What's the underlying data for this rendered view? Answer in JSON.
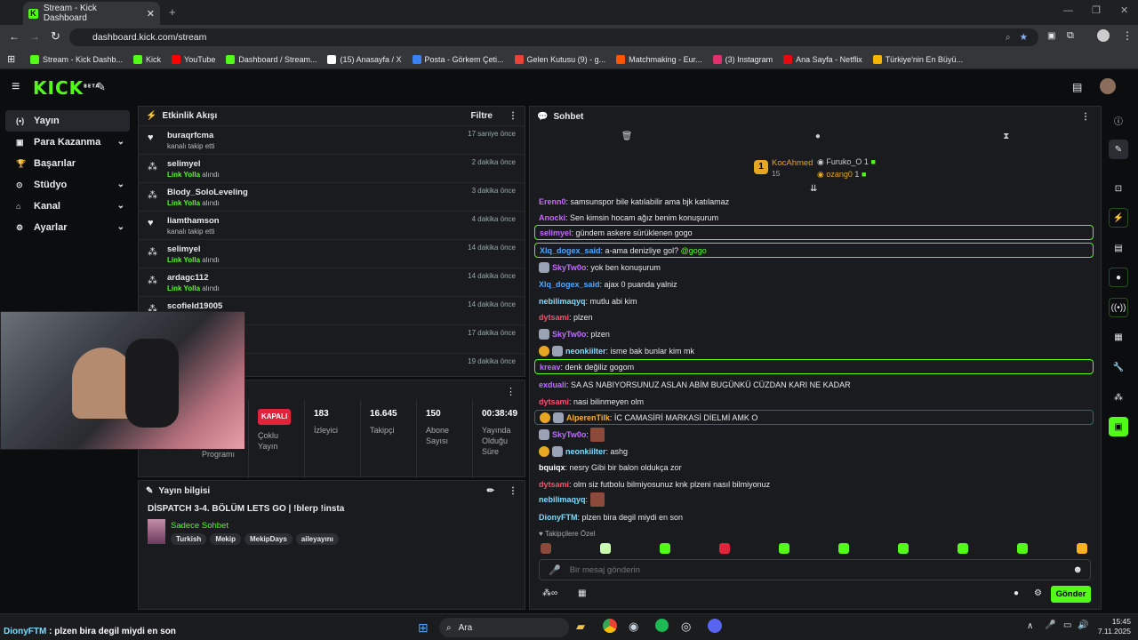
{
  "browser": {
    "tab_title": "Stream - Kick Dashboard",
    "url": "dashboard.kick.com/stream",
    "bookmarks": [
      {
        "label": "Stream - Kick Dashb...",
        "icon": "kick-icon",
        "color": "#53fc18"
      },
      {
        "label": "Kick",
        "icon": "kick-icon",
        "color": "#53fc18"
      },
      {
        "label": "YouTube",
        "icon": "youtube-icon",
        "color": "#ff0000"
      },
      {
        "label": "Dashboard / Stream...",
        "icon": "kick-icon",
        "color": "#53fc18"
      },
      {
        "label": "(15) Anasayfa / X",
        "icon": "x-icon",
        "color": "#ffffff"
      },
      {
        "label": "Posta - Görkem Çeti...",
        "icon": "mail-icon",
        "color": "#3b82f6"
      },
      {
        "label": "Gelen Kutusu (9) - g...",
        "icon": "gmail-icon",
        "color": "#ea4335"
      },
      {
        "label": "Matchmaking - Eur...",
        "icon": "faceit-icon",
        "color": "#ff5500"
      },
      {
        "label": "(3) Instagram",
        "icon": "instagram-icon",
        "color": "#e1306c"
      },
      {
        "label": "Ana Sayfa - Netflix",
        "icon": "netflix-icon",
        "color": "#e50914"
      },
      {
        "label": "Türkiye'nin En Büyü...",
        "icon": "site-icon",
        "color": "#f5b400"
      }
    ]
  },
  "app": {
    "logo": "KICK",
    "logo_badge": "BETA",
    "accent": "#53fc18"
  },
  "sidebar": {
    "items": [
      {
        "label": "Yayın",
        "icon": "broadcast-icon",
        "active": true,
        "chevron": false
      },
      {
        "label": "Para Kazanma",
        "icon": "money-icon",
        "active": false,
        "chevron": true
      },
      {
        "label": "Başarılar",
        "icon": "trophy-icon",
        "active": false,
        "chevron": false
      },
      {
        "label": "Stüdyo",
        "icon": "studio-icon",
        "active": false,
        "chevron": true
      },
      {
        "label": "Kanal",
        "icon": "channel-icon",
        "active": false,
        "chevron": true
      },
      {
        "label": "Ayarlar",
        "icon": "settings-icon",
        "active": false,
        "chevron": true
      }
    ]
  },
  "activity": {
    "title": "Etkinlik Akışı",
    "filter": "Filtre",
    "items": [
      {
        "name": "buraqrfcma",
        "sub_action": "kanalı takip etti",
        "sub_link": "",
        "time": "17 saniye önce",
        "icon": "heart-icon"
      },
      {
        "name": "selimyel",
        "sub_link": "Link Yolla",
        "sub_action": "alındı",
        "time": "2 dakika önce",
        "icon": "points-icon"
      },
      {
        "name": "Blody_SoloLeveling",
        "sub_link": "Link Yolla",
        "sub_action": "alındı",
        "time": "3 dakika önce",
        "icon": "points-icon"
      },
      {
        "name": "liamthamson",
        "sub_action": "kanalı takip etti",
        "sub_link": "",
        "time": "4 dakika önce",
        "icon": "heart-icon"
      },
      {
        "name": "selimyel",
        "sub_link": "Link Yolla",
        "sub_action": "alındı",
        "time": "14 dakika önce",
        "icon": "points-icon"
      },
      {
        "name": "ardagc112",
        "sub_link": "Link Yolla",
        "sub_action": "alındı",
        "time": "14 dakika önce",
        "icon": "points-icon"
      },
      {
        "name": "scofield19005",
        "sub_link": "",
        "sub_action": "",
        "time": "14 dakika önce",
        "icon": "points-icon"
      },
      {
        "name": "",
        "sub_link": "",
        "sub_action": "",
        "time": "17 dakika önce",
        "icon": ""
      },
      {
        "name": "",
        "sub_link": "",
        "sub_action": "",
        "time": "19 dakika önce",
        "icon": ""
      }
    ]
  },
  "stats": {
    "program_label": "Programı",
    "status_badge": "KAPALI",
    "multi_label": "Çoklu Yayın",
    "viewers": {
      "value": "183",
      "label": "İzleyici"
    },
    "followers": {
      "value": "16.645",
      "label": "Takipçi"
    },
    "subs": {
      "value": "150",
      "label": "Abone Sayısı"
    },
    "uptime": {
      "value": "00:38:49",
      "label": "Yayında Olduğu Süre"
    }
  },
  "stream_info": {
    "title": "Yayın bilgisi",
    "stream_title": "DİSPATCH 3-4. BÖLÜM LETS GO | !blerp !insta",
    "category": "Sadece Sohbet",
    "tags": [
      "Turkish",
      "Mekip",
      "MekipDays",
      "aileyayını"
    ]
  },
  "chat": {
    "title": "Sohbet",
    "top_user": "KocAhmed",
    "top_count": "15",
    "side_users": [
      {
        "name": "Furuko_O",
        "count": "1"
      },
      {
        "name": "ozang0",
        "count": "1"
      }
    ],
    "messages": [
      {
        "user": "Erenn0",
        "color": "#c46bff",
        "text": ": samsunspor bile katılabilir ama bjk katılamaz",
        "style": ""
      },
      {
        "user": "Anocki",
        "color": "#c46bff",
        "text": ": Sen kimsin hocam ağız benim konuşurum",
        "style": ""
      },
      {
        "user": "selimyel",
        "color": "#c46bff",
        "text": ": gündem askere sürüklenen gogo",
        "style": "hl"
      },
      {
        "user": "Xlq_dogex_said",
        "color": "#4ea7ff",
        "text": ": a-ama denizliye gol? ",
        "mention": "@gogo",
        "style": "hl"
      },
      {
        "user": "SkyTw0o",
        "color": "#c46bff",
        "text": ": yok ben konuşurum",
        "style": "",
        "avatar": true
      },
      {
        "user": "Xlq_dogex_said",
        "color": "#4ea7ff",
        "text": ": ajax 0 puanda yalniz",
        "style": ""
      },
      {
        "user": "nebilimaqyq",
        "color": "#7fdcff",
        "text": ": mutlu abi kim",
        "style": ""
      },
      {
        "user": "dytsami",
        "color": "#ff4d6d",
        "text": ": plzen",
        "style": ""
      },
      {
        "user": "SkyTw0o",
        "color": "#c46bff",
        "text": ": plzen",
        "style": "",
        "avatar": true
      },
      {
        "user": "neonkiilter",
        "color": "#7fdcff",
        "text": ": isme bak bunlar kim mk",
        "style": "",
        "avatar": true,
        "badge": true
      },
      {
        "user": "kreav",
        "color": "#c46bff",
        "text": ": denk değiliz gogom",
        "style": "hl"
      },
      {
        "user": "exduali",
        "color": "#c46bff",
        "text": ": SA AS NABIYORSUNUZ ASLAN ABİM BUGÜNKÜ CÜZDAN KARI NE KADAR",
        "style": ""
      },
      {
        "user": "dytsami",
        "color": "#ff4d6d",
        "text": ": nasi bilinmeyen olm",
        "style": ""
      },
      {
        "user": "AlperenTilk",
        "color": "#ffb020",
        "text": ": İC CAMASİRİ MARKASİ DİELMİ AMK O",
        "style": "hb",
        "avatar": true,
        "badge": true
      },
      {
        "user": "SkyTw0o",
        "color": "#c46bff",
        "text": ": ",
        "style": "",
        "avatar": true,
        "emote": true
      },
      {
        "user": "neonkiilter",
        "color": "#7fdcff",
        "text": ": ashg",
        "style": "",
        "avatar": true,
        "badge": true
      },
      {
        "user": "bquiqx",
        "color": "#ffffff",
        "text": ": nesry Gibi bir balon oldukça zor",
        "style": ""
      },
      {
        "user": "dytsami",
        "color": "#ff4d6d",
        "text": ": olm siz futbolu bilmiyosunuz knk plzeni nasıl bilmiyonuz",
        "style": ""
      },
      {
        "user": "nebilimaqyq",
        "color": "#7fdcff",
        "text": ": ",
        "style": "",
        "emote": true
      },
      {
        "user": "DionyFTM",
        "color": "#7fdcff",
        "text": ": plzen bira degil miydi en son",
        "style": ""
      }
    ],
    "followers_only": "Takipçilere Özel",
    "placeholder": "Bir mesaj gönderin",
    "send": "Gönder"
  },
  "overlay_caption": {
    "user": "DionyFTM",
    "text": " : plzen bira degil miydi en son"
  },
  "taskbar": {
    "search": "Ara",
    "time": "15:45",
    "date": "7.11.2025"
  }
}
